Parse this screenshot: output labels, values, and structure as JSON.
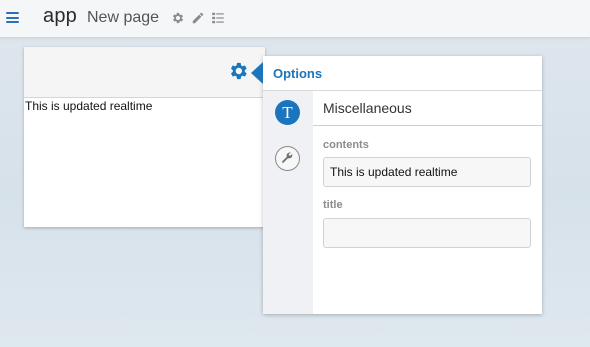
{
  "topbar": {
    "app_title": "app",
    "page_title": "New page"
  },
  "widget": {
    "content_text": "This is updated realtime"
  },
  "options": {
    "header": "Options",
    "section_title": "Miscellaneous",
    "text_tab_glyph": "T",
    "fields": {
      "contents_label": "contents",
      "contents_value": "This is updated realtime",
      "title_label": "title",
      "title_value": ""
    }
  },
  "colors": {
    "accent": "#1b75bc",
    "topbar_bg": "#f4f6f8",
    "sidebar_bg": "#f0f1f4"
  },
  "icons": [
    "hamburger-menu-icon",
    "gear-icon",
    "pencil-icon",
    "list-icon",
    "widget-gear-icon",
    "text-icon",
    "wrench-icon"
  ]
}
